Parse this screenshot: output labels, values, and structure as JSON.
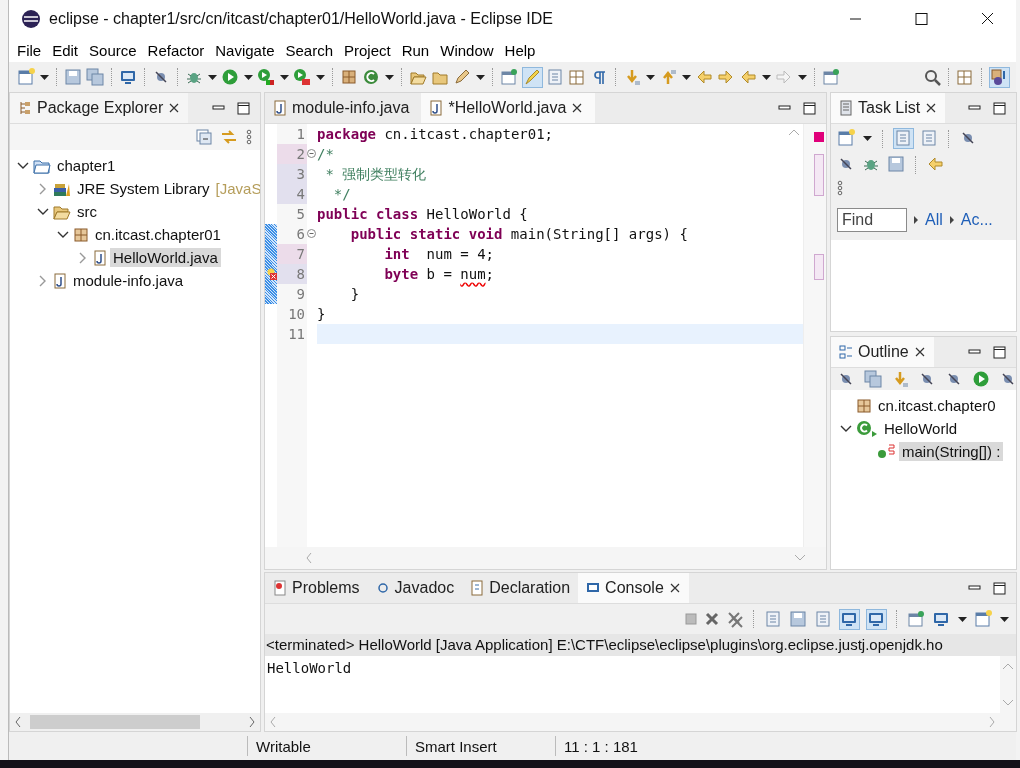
{
  "window": {
    "title": "eclipse - chapter1/src/cn/itcast/chapter01/HelloWorld.java - Eclipse IDE"
  },
  "menu": [
    "File",
    "Edit",
    "Source",
    "Refactor",
    "Navigate",
    "Search",
    "Project",
    "Run",
    "Window",
    "Help"
  ],
  "package_explorer": {
    "title": "Package Explorer",
    "tree": [
      {
        "label": "chapter1",
        "kind": "project",
        "expanded": true,
        "selected": false,
        "children": [
          {
            "label": "JRE System Library",
            "decoration": "[JavaS",
            "kind": "library",
            "expanded": false,
            "selected": false
          },
          {
            "label": "src",
            "kind": "folder",
            "expanded": true,
            "selected": false,
            "children": [
              {
                "label": "cn.itcast.chapter01",
                "kind": "package",
                "expanded": true,
                "selected": false,
                "children": [
                  {
                    "label": "HelloWorld.java",
                    "kind": "java",
                    "expanded": false,
                    "selected": true
                  }
                ]
              }
            ]
          },
          {
            "label": "module-info.java",
            "kind": "java",
            "expanded": false,
            "selected": false
          }
        ]
      }
    ]
  },
  "editor": {
    "tabs": [
      {
        "label": "module-info.java",
        "selected": false
      },
      {
        "label": "*HelloWorld.java",
        "selected": true
      }
    ],
    "lines": [
      {
        "number": "1",
        "text": "**package** cn.itcast.chapter01;",
        "kind": "code"
      },
      {
        "number": "2",
        "text": "/*",
        "kind": "comment",
        "fold": true,
        "changed": true
      },
      {
        "number": "3",
        "text": " * 强制类型转化",
        "kind": "comment",
        "added": true
      },
      {
        "number": "4",
        "text": "  */",
        "kind": "comment",
        "added": true
      },
      {
        "number": "5",
        "text": "**public class** HelloWorld {",
        "kind": "code"
      },
      {
        "number": "6",
        "text": "    **public static void** main(String[] args) {",
        "kind": "code",
        "fold": true,
        "range": true
      },
      {
        "number": "7",
        "text": "        **int**  num = 4;",
        "kind": "code",
        "changed": true,
        "range": true
      },
      {
        "number": "8",
        "text": "        **byte** b = *num*;",
        "kind": "code",
        "added": true,
        "range": true,
        "error": true
      },
      {
        "number": "9",
        "text": "    }",
        "kind": "code",
        "range": true
      },
      {
        "number": "10",
        "text": "}",
        "kind": "code"
      },
      {
        "number": "11",
        "current": true
      }
    ]
  },
  "task_list": {
    "title": "Task List",
    "find": {
      "placeholder": "Find"
    },
    "filters": [
      "All",
      "Ac..."
    ]
  },
  "outline": {
    "title": "Outline",
    "tree": [
      {
        "label": "cn.itcast.chapter0",
        "kind": "package",
        "selected": false
      },
      {
        "label": "HelloWorld",
        "kind": "class",
        "expanded": true,
        "selected": false,
        "children": [
          {
            "label": "main(String[]) :",
            "kind": "method",
            "selected": true
          }
        ]
      }
    ]
  },
  "bottom": {
    "tabs": [
      {
        "label": "Problems",
        "selected": false
      },
      {
        "label": "Javadoc",
        "selected": false
      },
      {
        "label": "Declaration",
        "selected": false
      },
      {
        "label": "Console",
        "selected": true
      }
    ],
    "console_header": "<terminated> HelloWorld [Java Application] E:\\CTF\\eclipse\\eclipse\\plugins\\org.eclipse.justj.openjdk.ho",
    "console_output": "HelloWorld"
  },
  "status_bar": [
    "Writable",
    "Smart Insert",
    "11 : 1 : 181"
  ]
}
